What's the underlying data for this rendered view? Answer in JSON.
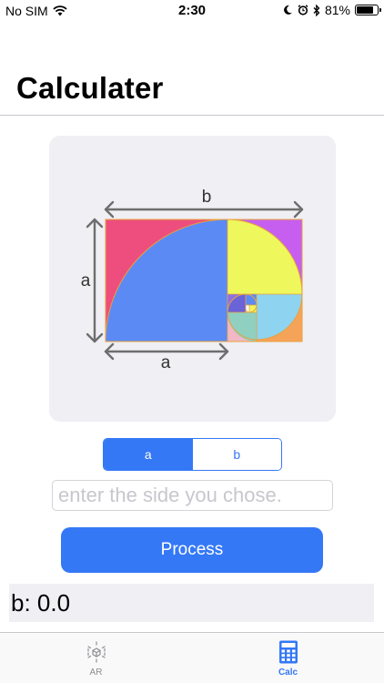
{
  "status_bar": {
    "carrier": "No SIM",
    "time": "2:30",
    "battery_percent": "81%",
    "battery_level": 0.81
  },
  "page": {
    "title": "Calculater"
  },
  "diagram": {
    "label_top": "b",
    "label_left": "a",
    "label_bottom": "a",
    "colors": {
      "pink": "#ed4e7e",
      "blue": "#5b8af5",
      "yellow": "#eef85d",
      "magenta": "#c65ff0",
      "light_blue": "#8ed3f0",
      "orange": "#f6a35a",
      "teal": "#8fd0c0",
      "arrow": "#6e6e6e"
    }
  },
  "segmented_control": {
    "options": [
      "a",
      "b"
    ],
    "selected": "a"
  },
  "input": {
    "placeholder": "enter the side you chose.",
    "value": ""
  },
  "process_button": {
    "label": "Process"
  },
  "result": {
    "text": "b: 0.0"
  },
  "tab_bar": {
    "items": [
      {
        "label": "AR",
        "icon": "ar-cube-icon",
        "active": false
      },
      {
        "label": "Calc",
        "icon": "calculator-icon",
        "active": true
      }
    ]
  },
  "colors": {
    "accent": "#3478f6",
    "card_background": "#efeff4"
  }
}
